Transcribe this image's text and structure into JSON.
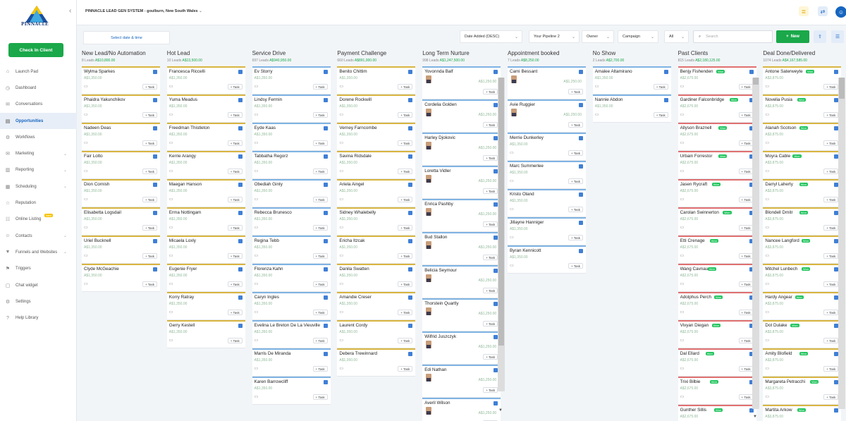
{
  "app": {
    "logo_text": "PINNACLE",
    "account": "PINNACLE LEAD GEN SYSTEM - goulburn, New South Wales",
    "checkin": "Check In Client"
  },
  "nav": [
    {
      "label": "Launch Pad",
      "icon": "rocket-icon",
      "g": "⌂"
    },
    {
      "label": "Dashboard",
      "icon": "dashboard-icon",
      "g": "◷"
    },
    {
      "label": "Conversations",
      "icon": "chat-icon",
      "g": "✉"
    },
    {
      "label": "Opportunities",
      "icon": "funnel-icon",
      "g": "▤",
      "active": true
    },
    {
      "label": "Workflows",
      "icon": "workflow-icon",
      "g": "⚙"
    },
    {
      "label": "Marketing",
      "icon": "marketing-icon",
      "g": "✉",
      "chev": true
    },
    {
      "label": "Reporting",
      "icon": "chart-icon",
      "g": "▥",
      "chev": true
    },
    {
      "label": "Scheduling",
      "icon": "calendar-icon",
      "g": "▦",
      "chev": true
    },
    {
      "label": "Reputation",
      "icon": "star-icon",
      "g": "☆"
    },
    {
      "label": "Online Listing",
      "icon": "listing-icon",
      "g": "☷",
      "badge": "New"
    },
    {
      "label": "Contacts",
      "icon": "contacts-icon",
      "g": "☺",
      "chev": true
    },
    {
      "label": "Funnels and Websites",
      "icon": "filter-icon",
      "g": "▼",
      "chev": true
    },
    {
      "label": "Triggers",
      "icon": "trigger-icon",
      "g": "⚑"
    },
    {
      "label": "Chat widget",
      "icon": "widget-icon",
      "g": "▢"
    },
    {
      "label": "Settings",
      "icon": "settings-icon",
      "g": "⚙"
    },
    {
      "label": "Help Library",
      "icon": "help-icon",
      "g": "?"
    }
  ],
  "filters": {
    "date": "Select date & time",
    "sort": "Date Added (DESC)",
    "pipeline": "Your Pipeline 2",
    "owner": "Owner",
    "campaign": "Campaign",
    "status": "All",
    "search_placeholder": "Search",
    "new": "New"
  },
  "task_label": "+ Task",
  "won_label": "Won",
  "columns": [
    {
      "title": "New Lead/No Automation",
      "sub": "8 Leads",
      "amt": "A$10,800.00",
      "style": "basic",
      "border": "#d9b540",
      "cards": [
        {
          "name": "Wylma Sparkes",
          "price": "A$1,350.00"
        },
        {
          "name": "Phaidra Yakunchikov",
          "price": "A$1,350.00"
        },
        {
          "name": "Nadeen Deas",
          "price": "A$1,350.00"
        },
        {
          "name": "Fair Lotto",
          "price": "A$1,350.00"
        },
        {
          "name": "Dion Cornish",
          "price": "A$1,350.00"
        },
        {
          "name": "Elisabetta Logsdail",
          "price": "A$1,350.00"
        },
        {
          "name": "Uriel Bucknell",
          "price": "A$1,350.00"
        },
        {
          "name": "Clyde McGeachie",
          "price": "A$1,350.00"
        }
      ]
    },
    {
      "title": "Hot Lead",
      "sub": "10 Leads",
      "amt": "A$13,500.00",
      "style": "basic",
      "border": "#d9b540",
      "cards": [
        {
          "name": "Francesca Riccelli",
          "price": "A$1,350.00"
        },
        {
          "name": "Yuma Meadus",
          "price": "A$1,350.00"
        },
        {
          "name": "Freedman Thistleton",
          "price": "A$1,350.00"
        },
        {
          "name": "Kerrie Arangy",
          "price": "A$1,350.00"
        },
        {
          "name": "Maegan Hanson",
          "price": "A$1,350.00"
        },
        {
          "name": "Erma Nottingam",
          "price": "A$1,350.00"
        },
        {
          "name": "Micaela Loxly",
          "price": "A$1,350.00"
        },
        {
          "name": "Eugenie Fryer",
          "price": "A$1,350.00"
        },
        {
          "name": "Korry Ratray",
          "price": "A$1,350.00"
        },
        {
          "name": "Gerry Kestell",
          "price": "A$1,350.00"
        }
      ]
    },
    {
      "title": "Service Drive",
      "sub": "697 Leads",
      "amt": "A$940,950.00",
      "style": "basic",
      "border": "#7fb3e3",
      "cards": [
        {
          "name": "Ev Storry",
          "price": "A$1,350.00"
        },
        {
          "name": "Lindsy Fermin",
          "price": "A$1,350.00"
        },
        {
          "name": "Eyde Kaas",
          "price": "A$1,350.00"
        },
        {
          "name": "Tabbatha Regorz",
          "price": "A$1,350.00"
        },
        {
          "name": "Obediah Ginty",
          "price": "A$1,350.00"
        },
        {
          "name": "Rebecca Brunesco",
          "price": "A$1,350.00"
        },
        {
          "name": "Regina Tebb",
          "price": "A$1,350.00"
        },
        {
          "name": "Florenza Kahn",
          "price": "A$1,350.00"
        },
        {
          "name": "Caryn Ingles",
          "price": "A$1,350.00"
        },
        {
          "name": "Evelina Le Breton De La Vieuville",
          "price": "A$1,350.00"
        },
        {
          "name": "Marris De Miranda",
          "price": "A$1,350.00"
        },
        {
          "name": "Karen Barrowcliff",
          "price": "A$1,350.00"
        }
      ]
    },
    {
      "title": "Payment Challenge",
      "sub": "660 Leads",
      "amt": "A$891,000.00",
      "style": "basic",
      "border": "#d9b540",
      "cards": [
        {
          "name": "Benito Chittim",
          "price": "A$1,350.00"
        },
        {
          "name": "Dorene Rockwill",
          "price": "A$1,350.00"
        },
        {
          "name": "Verney Farncombe",
          "price": "A$1,350.00"
        },
        {
          "name": "Savina Ridsdale",
          "price": "A$1,350.00"
        },
        {
          "name": "Ariela Aingel",
          "price": "A$1,350.00"
        },
        {
          "name": "Sidney Whalebelly",
          "price": "A$1,350.00"
        },
        {
          "name": "Ericha Itzcak",
          "price": "A$1,350.00"
        },
        {
          "name": "Danila Swatten",
          "price": "A$1,350.00"
        },
        {
          "name": "Amandie Creser",
          "price": "A$1,350.00"
        },
        {
          "name": "Laurent Cordy",
          "price": "A$1,350.00"
        },
        {
          "name": "Debera Trewinnard",
          "price": "A$1,350.00"
        }
      ]
    },
    {
      "title": "Long Term Nurture",
      "sub": "998 Leads",
      "amt": "A$1,247,500.00",
      "style": "avatar",
      "border": "#7fb3e3",
      "cards": [
        {
          "name": "Yovonnda Balf",
          "price": "A$1,250.00"
        },
        {
          "name": "Cordelia Golden",
          "price": "A$1,250.00"
        },
        {
          "name": "Harley Djokovic",
          "price": "A$1,250.00"
        },
        {
          "name": "Loretta Vidler",
          "price": "A$1,250.00"
        },
        {
          "name": "Enrica Pashby",
          "price": "A$1,250.00"
        },
        {
          "name": "Bud Stallon",
          "price": "A$1,250.00"
        },
        {
          "name": "Belicia Seymour",
          "price": "A$1,250.00"
        },
        {
          "name": "Thorstein Quartly",
          "price": "A$1,250.00"
        },
        {
          "name": "Wilfrid Juszczyk",
          "price": "A$1,250.00"
        },
        {
          "name": "Edi Nathan",
          "price": "A$1,250.00"
        },
        {
          "name": "Averil Wilson",
          "price": "A$1,250.00"
        }
      ]
    },
    {
      "title": "Appointment booked",
      "sub": "7 Leads",
      "amt": "A$8,250.00",
      "style": "mixed",
      "border": "#7fb3e3",
      "cards": [
        {
          "name": "Cami Bessant",
          "price": "A$1,250.00",
          "av": true
        },
        {
          "name": "Avie Ruggier",
          "price": "A$1,250.00",
          "av": true
        },
        {
          "name": "Merrie Dunkerley",
          "price": "A$1,350.00"
        },
        {
          "name": "Marc Summerlee",
          "price": "A$1,350.00"
        },
        {
          "name": "Kristo Oland",
          "price": "A$1,350.00"
        },
        {
          "name": "Jillayne Hanniger",
          "price": "A$1,350.00"
        },
        {
          "name": "Byran Kennicott",
          "price": "A$1,350.00"
        }
      ]
    },
    {
      "title": "No Show",
      "sub": "2 Leads",
      "amt": "A$2,700.00",
      "style": "basic",
      "border": "#7fb3e3",
      "cards": [
        {
          "name": "Amalee Altamirano",
          "price": "A$1,350.00"
        },
        {
          "name": "Nannie Abdon",
          "price": "A$1,350.00"
        }
      ]
    },
    {
      "title": "Past Clients",
      "sub": "815 Leads",
      "amt": "A$2,180,125.00",
      "style": "won",
      "border": "#e07070",
      "cards": [
        {
          "name": "Benjy Fishenden",
          "price": "A$2,675.00"
        },
        {
          "name": "Gardiner Falconbridge",
          "price": "A$2,675.00"
        },
        {
          "name": "Allyson Braznell",
          "price": "A$2,675.00"
        },
        {
          "name": "Urbain Forrestor",
          "price": "A$2,675.00"
        },
        {
          "name": "Jasen Rycraft",
          "price": "A$2,675.00"
        },
        {
          "name": "Carolan Swinnerton",
          "price": "A$2,675.00"
        },
        {
          "name": "Etti Crenage",
          "price": "A$2,675.00"
        },
        {
          "name": "Wang Cavnau",
          "price": "A$2,675.00"
        },
        {
          "name": "Adolphus Perch",
          "price": "A$2,675.00"
        },
        {
          "name": "Vivyan Diegan",
          "price": "A$2,675.00"
        },
        {
          "name": "Dal Ellard",
          "price": "A$2,675.00"
        },
        {
          "name": "Trixi Bilbie",
          "price": "A$2,675.00"
        },
        {
          "name": "Gunther Sillis",
          "price": "A$2,675.00"
        }
      ]
    },
    {
      "title": "Deal Done/Delivered",
      "sub": "1074 Leads",
      "amt": "A$4,167,585.00",
      "style": "won",
      "border": "#d9b540",
      "cards": [
        {
          "name": "Antone Saterweyte",
          "price": "A$3,875.00"
        },
        {
          "name": "Novelia Pusia",
          "price": "A$3,875.00"
        },
        {
          "name": "Alanah Scotson",
          "price": "A$3,875.00"
        },
        {
          "name": "Moyra Cable",
          "price": "A$3,875.00"
        },
        {
          "name": "Darryl Laherty",
          "price": "A$3,875.00"
        },
        {
          "name": "Blondell Dmitr",
          "price": "A$3,875.00"
        },
        {
          "name": "Nancee Langford",
          "price": "A$3,875.00"
        },
        {
          "name": "Mitchel Lunbech",
          "price": "A$3,875.00"
        },
        {
          "name": "Hardy Angear",
          "price": "A$3,875.00"
        },
        {
          "name": "Dot Dulake",
          "price": "A$3,875.00"
        },
        {
          "name": "Amity Blofield",
          "price": "A$3,875.00"
        },
        {
          "name": "Margareta Petracchi",
          "price": "A$3,875.00"
        },
        {
          "name": "Martita Arkow",
          "price": "A$3,875.00"
        }
      ]
    }
  ]
}
